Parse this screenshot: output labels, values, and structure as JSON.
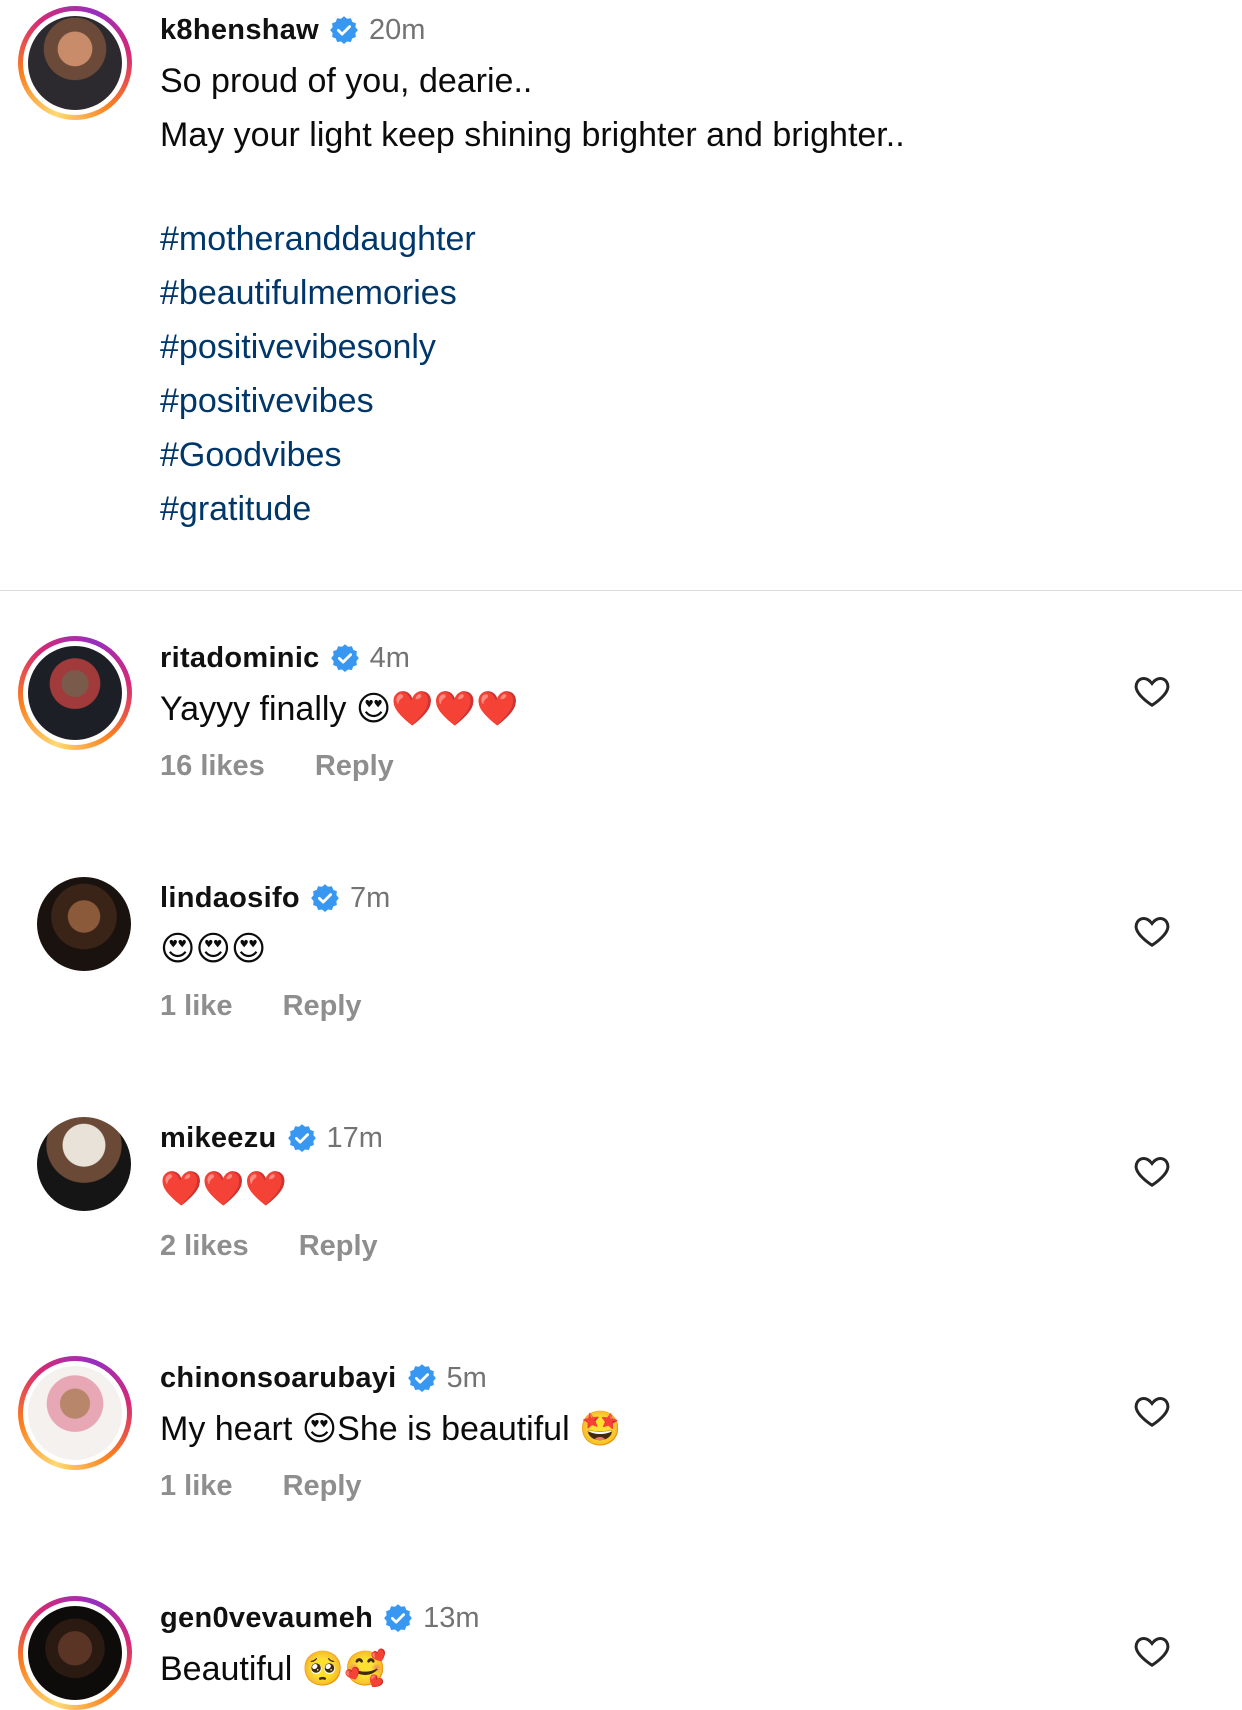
{
  "caption": {
    "username": "k8henshaw",
    "time": "20m",
    "lines": [
      "So proud of you, dearie..",
      "May your light keep shining brighter and brighter.."
    ],
    "hashtags": [
      "#motheranddaughter",
      "#beautifulmemories",
      "#positivevibesonly",
      "#positivevibes",
      "#Goodvibes",
      "#gratitude"
    ]
  },
  "comments": [
    {
      "username": "ritadominic",
      "time": "4m",
      "text": "Yayyy finally 😍❤️❤️❤️",
      "likes": "16 likes",
      "reply": "Reply"
    },
    {
      "username": "lindaosifo",
      "time": "7m",
      "text": "😍😍😍",
      "likes": "1 like",
      "reply": "Reply"
    },
    {
      "username": "mikeezu",
      "time": "17m",
      "text": "❤️❤️❤️",
      "likes": "2 likes",
      "reply": "Reply"
    },
    {
      "username": "chinonsoarubayi",
      "time": "5m",
      "text": "My heart 😍She is beautiful 🤩",
      "likes": "1 like",
      "reply": "Reply"
    },
    {
      "username": "gen0vevaumeh",
      "time": "13m",
      "text": "Beautiful 🥺🥰"
    }
  ],
  "colors": {
    "link": "#00376b",
    "verified": "#3897f0",
    "muted": "#737373",
    "meta": "#8e8e8e",
    "divider": "#dbdbdb"
  },
  "icons": [
    "verified-badge-icon",
    "heart-outline-icon"
  ]
}
